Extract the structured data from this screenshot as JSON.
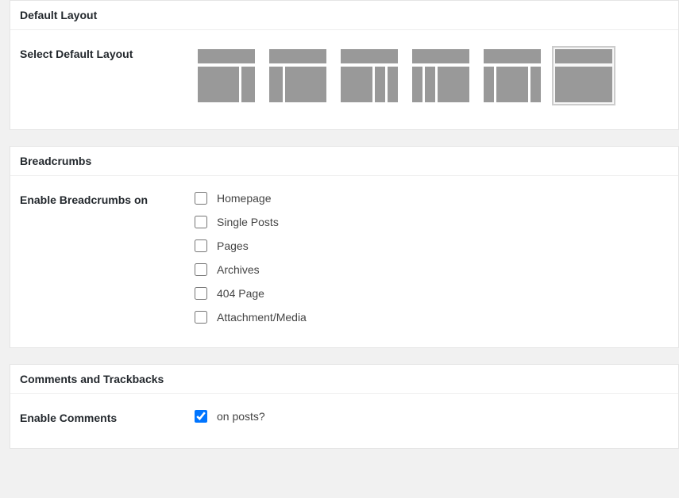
{
  "sections": {
    "layout": {
      "title": "Default Layout",
      "label": "Select Default Layout"
    },
    "breadcrumbs": {
      "title": "Breadcrumbs",
      "label": "Enable Breadcrumbs on",
      "options": {
        "homepage": "Homepage",
        "single_posts": "Single Posts",
        "pages": "Pages",
        "archives": "Archives",
        "page_404": "404 Page",
        "attachment": "Attachment/Media"
      }
    },
    "comments": {
      "title": "Comments and Trackbacks",
      "label": "Enable Comments",
      "options": {
        "on_posts": "on posts?"
      }
    }
  }
}
